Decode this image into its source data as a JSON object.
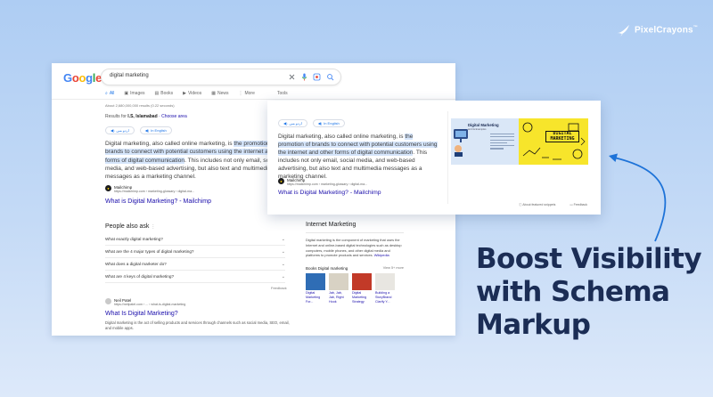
{
  "brand": {
    "name": "PixelCrayons",
    "mark": "™"
  },
  "headline": {
    "line1": "Boost Visibility",
    "line2": "with Schema",
    "line3": "Markup"
  },
  "colors": {
    "background_top": "#aecdf3",
    "headline": "#1b2d55",
    "arrow": "#1e73d8",
    "highlight": "#d5e5fb",
    "link": "#1a0dab",
    "google_blue": "#1a73e8"
  },
  "back_serp": {
    "logo": [
      "G",
      "o",
      "o",
      "g",
      "l",
      "e"
    ],
    "query": "digital marketing",
    "tabs": [
      {
        "label": "All",
        "icon": "search-icon"
      },
      {
        "label": "Images",
        "icon": "image-icon"
      },
      {
        "label": "Books",
        "icon": "book-icon"
      },
      {
        "label": "Videos",
        "icon": "video-icon"
      },
      {
        "label": "News",
        "icon": "news-icon"
      },
      {
        "label": "More",
        "icon": "more-icon"
      }
    ],
    "tools": "Tools",
    "result_count": "About 2,680,000,000 results (0.22 seconds)",
    "results_for_prefix": "Results for",
    "results_for_place": "I.S, Islamabad",
    "results_for_link": "· Choose area",
    "listen_urdu": "اردو میں",
    "listen_english": "In English",
    "snippet": {
      "before": "Digital marketing, also called online marketing, is ",
      "highlight": "the promotion of brands to connect with potential customers using the internet and other forms of digital communication",
      "after": ". This includes not only email, social media, and web-based advertising, but also text and multimedia messages as a marketing channel."
    },
    "source": {
      "name": "Mailchimp",
      "url": "https://mailchimp.com › marketing-glossary › digital-ma...",
      "title": "What is Digital Marketing? - Mailchimp"
    },
    "paa": {
      "title": "People also ask",
      "questions": [
        "What exactly digital marketing?",
        "What are the 4 major types of digital marketing?",
        "What does a digital marketer do?",
        "What are 4 keys of digital marketing?"
      ],
      "feedback": "Feedback"
    },
    "second_result": {
      "name": "Neil Patel",
      "url": "https://neilpatel.com › ... › what-is-digital-marketing",
      "title": "What Is Digital Marketing?",
      "desc": "Digital marketing is the act of selling products and services through channels such as social media, SEO, email, and mobile apps."
    },
    "knowledge_panel": {
      "title": "Internet Marketing",
      "desc": "Digital marketing is the component of marketing that uses the Internet and online-based digital technologies such as desktop computers, mobile phones, and other digital media and platforms to promote products and services.",
      "desc_link": "Wikipedia",
      "books_heading": "Books Digital marketing",
      "books_more": "View 5+ more",
      "books": [
        {
          "title": "Digital Marketing For...",
          "color": "#2f6db5"
        },
        {
          "title": "Jab, Jab, Jab, Right Hook",
          "color": "#d8d2c4"
        },
        {
          "title": "Digital Marketing Strategy",
          "color": "#c23a28"
        },
        {
          "title": "Building a StoryBrand Clarify Y...",
          "color": "#e8e6e1"
        }
      ]
    }
  },
  "front_card": {
    "listen_urdu": "اردو میں",
    "listen_english": "In English",
    "snippet": {
      "before": "Digital marketing, also called online marketing, is ",
      "highlight": "the promotion of brands to connect with potential customers using the internet and other forms of digital communication",
      "after": ". This includes not only email, social media, and web-based advertising, but also text and multimedia messages as a marketing channel."
    },
    "source": {
      "name": "Mailchimp",
      "url": "https://mailchimp.com › marketing-glossary › digital-ma...",
      "title": "What is Digital Marketing? - Mailchimp"
    },
    "image": {
      "left_title": "Digital Marketing",
      "left_subtitle": "and its Examples",
      "right_text_1": "DIGITAL",
      "right_text_2": "MARKETING"
    },
    "footer_about": "About featured snippets",
    "footer_feedback": "Feedback"
  }
}
